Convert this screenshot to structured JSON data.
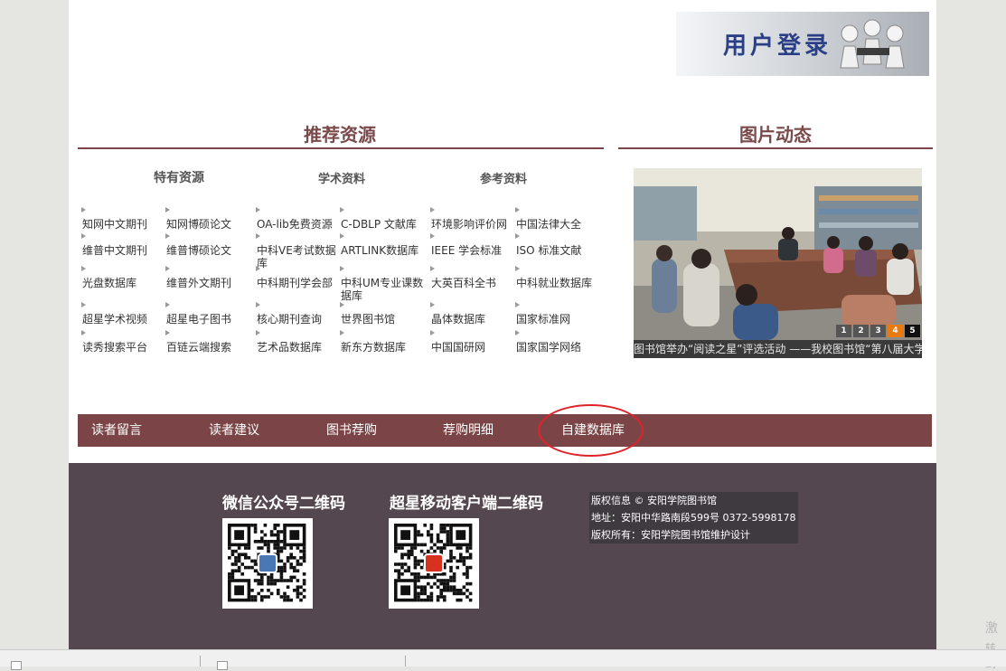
{
  "login": {
    "label": "用户登录"
  },
  "recommend": {
    "title": "推荐资源",
    "categories": [
      "特有资源",
      "学术资料",
      "参考资料"
    ],
    "rows": [
      [
        "知网中文期刊",
        "知网博硕论文",
        "OA-lib免费资源",
        "C-DBLP 文献库",
        "环境影响评价网",
        "中国法律大全"
      ],
      [
        "维普中文期刊",
        "维普博硕论文",
        "中科VE考试数据库",
        "ARTLINK数据库",
        "IEEE 学会标准",
        "ISO 标准文献"
      ],
      [
        "光盘数据库",
        "维普外文期刊",
        "中科期刊学会部",
        "中科UM专业课数据库",
        "大英百科全书",
        "中科就业数据库"
      ],
      [
        "超星学术视频",
        "超星电子图书",
        "核心期刊查询",
        "世界图书馆",
        "晶体数据库",
        "国家标准网"
      ],
      [
        "读秀搜索平台",
        "百链云端搜索",
        "艺术品数据库",
        "新东方数据库",
        "中国国研网",
        "国家国学网络"
      ]
    ]
  },
  "photos": {
    "title": "图片动态",
    "caption": "图书馆举办“阅读之星”评选活动 ——我校图书馆“第八届大学",
    "pager": [
      "1",
      "2",
      "3",
      "4",
      "5"
    ],
    "active_page": 4
  },
  "nav": {
    "items": [
      "读者留言",
      "读者建议",
      "图书荐购",
      "荐购明细",
      "自建数据库"
    ]
  },
  "footer": {
    "wechat_title": "微信公众号二维码",
    "mobile_title": "超星移动客户端二维码",
    "copyright": "版权信息 © 安阳学院图书馆",
    "address": "地址：安阳中华路南段599号 0372-5998178",
    "owner": "版权所有：安阳学院图书馆维护设计"
  },
  "watermark": {
    "line1": "激",
    "line2": "转到"
  },
  "colors": {
    "accent": "#7b4446",
    "footer_bg": "#54474f",
    "title_text": "#7a4a4a",
    "highlight_circle": "#e0232a",
    "pager_active": "#e87b0f"
  }
}
